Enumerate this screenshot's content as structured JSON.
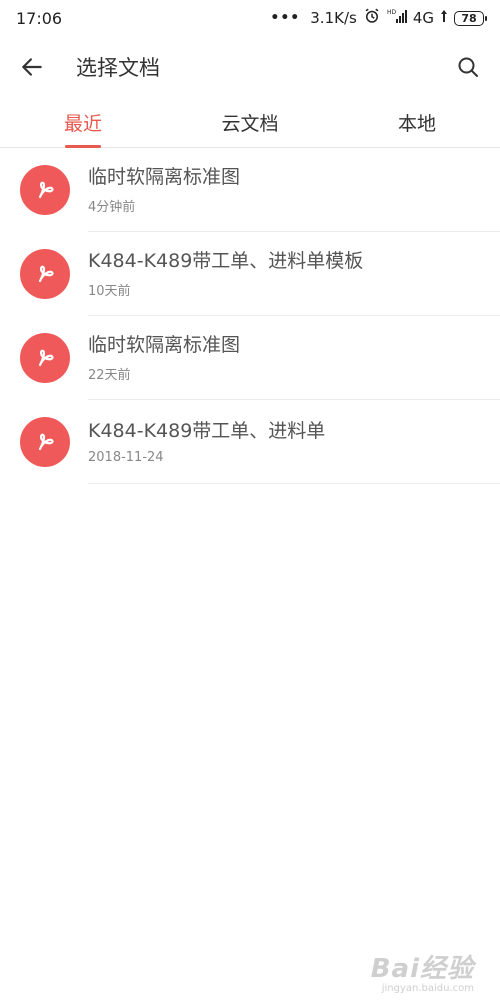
{
  "status_bar": {
    "time": "17:06",
    "dots": "•••",
    "speed": "3.1K/s",
    "network": "4G",
    "battery": "78"
  },
  "app_bar": {
    "title": "选择文档"
  },
  "tabs": [
    {
      "label": "最近",
      "active": true
    },
    {
      "label": "云文档",
      "active": false
    },
    {
      "label": "本地",
      "active": false
    }
  ],
  "files": [
    {
      "name": "临时软隔离标准图",
      "time": "4分钟前"
    },
    {
      "name": "K484-K489带工单、进料单模板",
      "time": "10天前"
    },
    {
      "name": "临时软隔离标准图",
      "time": "22天前"
    },
    {
      "name": "K484-K489带工单、进料单",
      "time": "2018-11-24"
    }
  ],
  "watermark": {
    "logo": "Bai经验",
    "url": "jingyan.baidu.com"
  },
  "colors": {
    "accent": "#e8594f",
    "file_icon": "#f0595a"
  }
}
